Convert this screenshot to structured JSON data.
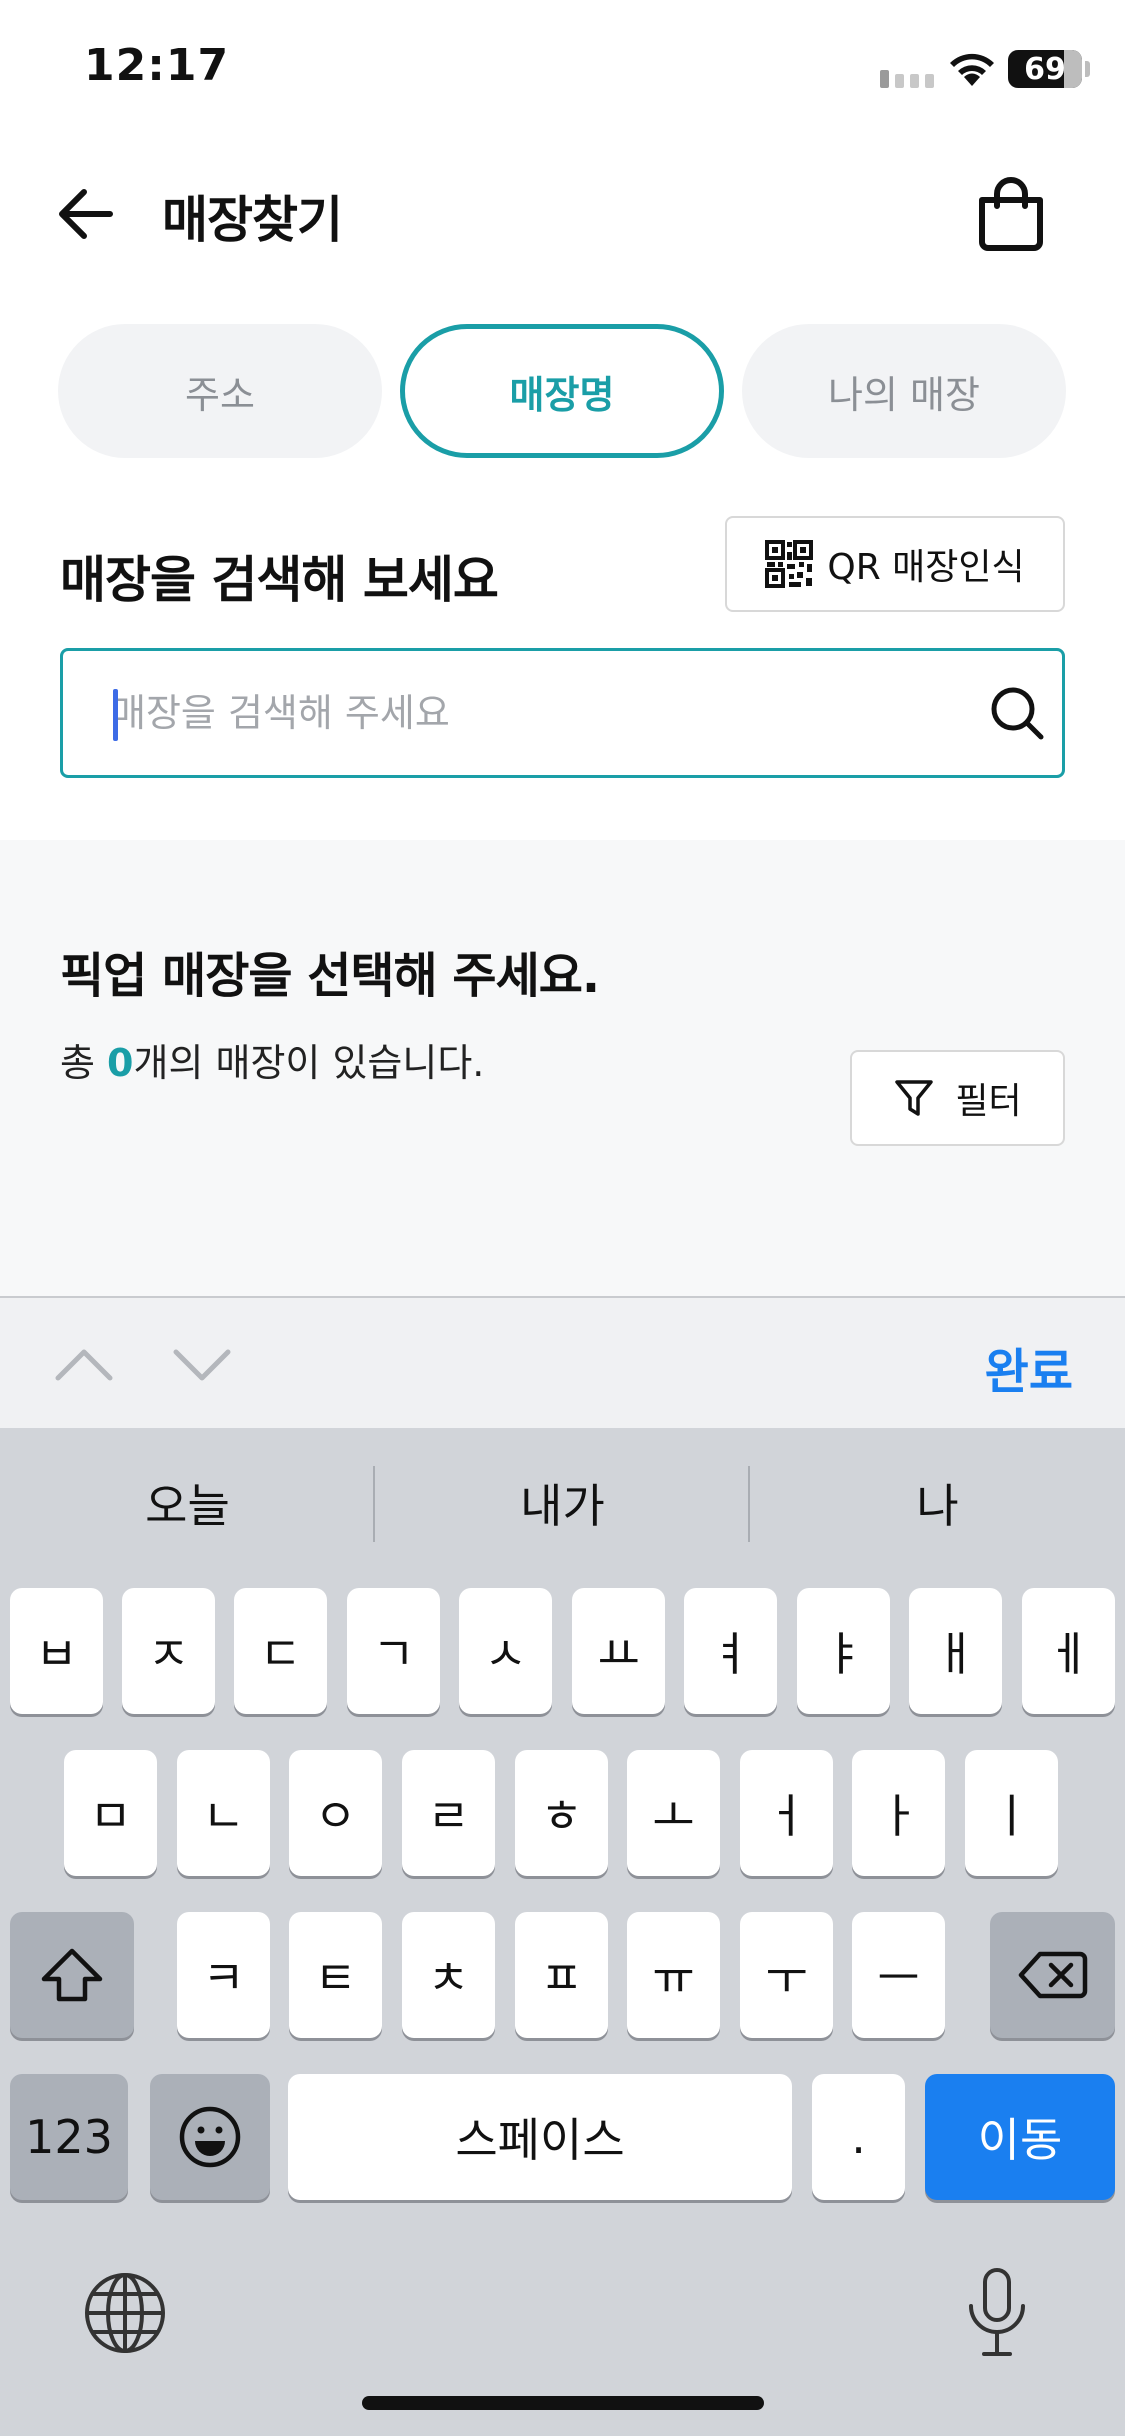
{
  "status_bar": {
    "time": "12:17",
    "battery": "69"
  },
  "header": {
    "title": "매장찾기",
    "icons": [
      "back-arrow-icon",
      "shopping-bag-icon"
    ]
  },
  "tabs": [
    {
      "label": "주소",
      "active": false
    },
    {
      "label": "매장명",
      "active": true
    },
    {
      "label": "나의 매장",
      "active": false
    }
  ],
  "search": {
    "heading": "매장을 검색해 보세요",
    "qr_label": "QR 매장인식",
    "placeholder": "매장을 검색해 주세요",
    "value": ""
  },
  "results": {
    "heading": "픽업 매장을 선택해 주세요.",
    "count_prefix": "총 ",
    "count": "0",
    "count_suffix": "개의 매장이 있습니다.",
    "filter_label": "필터"
  },
  "accessory": {
    "done_label": "완료"
  },
  "keyboard": {
    "suggestions": [
      "오늘",
      "내가",
      "나"
    ],
    "row1": [
      "ㅂ",
      "ㅈ",
      "ㄷ",
      "ㄱ",
      "ㅅ",
      "ㅛ",
      "ㅕ",
      "ㅑ",
      "ㅐ",
      "ㅔ"
    ],
    "row2": [
      "ㅁ",
      "ㄴ",
      "ㅇ",
      "ㄹ",
      "ㅎ",
      "ㅗ",
      "ㅓ",
      "ㅏ",
      "ㅣ"
    ],
    "row3": [
      "ㅋ",
      "ㅌ",
      "ㅊ",
      "ㅍ",
      "ㅠ",
      "ㅜ",
      "ㅡ"
    ],
    "numbers_label": "123",
    "space_label": "스페이스",
    "period_label": ".",
    "go_label": "이동"
  },
  "colors": {
    "accent": "#1a9ea7",
    "keyboard_blue": "#1a7ff0",
    "tab_inactive_bg": "#f2f3f5"
  }
}
